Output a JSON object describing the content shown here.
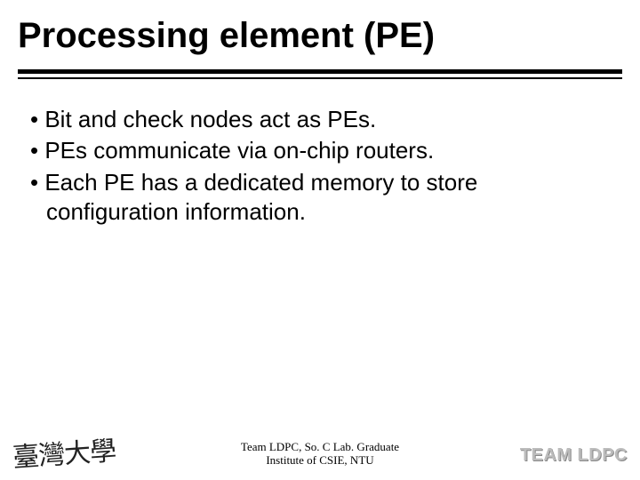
{
  "title": "Processing element (PE)",
  "bullets": [
    "Bit and check nodes act as PEs.",
    "PEs communicate via on-chip routers.",
    "Each PE has a dedicated memory to store configuration information."
  ],
  "footer": {
    "line1": "Team LDPC, So. C Lab. Graduate",
    "line2": "Institute of CSIE, NTU"
  },
  "logo_left": "臺灣大學",
  "logo_right": "TEAM LDPC"
}
